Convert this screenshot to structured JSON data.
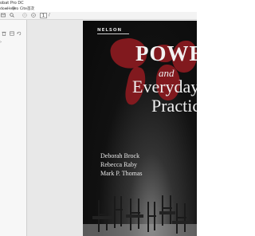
{
  "window": {
    "title": "obat Pro DC"
  },
  "menubar": {
    "items": [
      "dow",
      "Help",
      "Pro",
      "Cite",
      "首次"
    ]
  },
  "toolbar": {
    "page_current": "1",
    "page_total": "/"
  },
  "sidebar": {
    "chevron": "›",
    "scroll_handle": "‹"
  },
  "cover": {
    "publisher": "NELSON",
    "title_line1": "POWER",
    "title_line2": "and",
    "title_line3": "Everyday",
    "title_line4": "Practices",
    "authors": [
      "Deborah Brock",
      "Rebecca Raby",
      "Mark P. Thomas"
    ],
    "colors": {
      "map": "#8b1a1f",
      "background": "#111111"
    }
  }
}
